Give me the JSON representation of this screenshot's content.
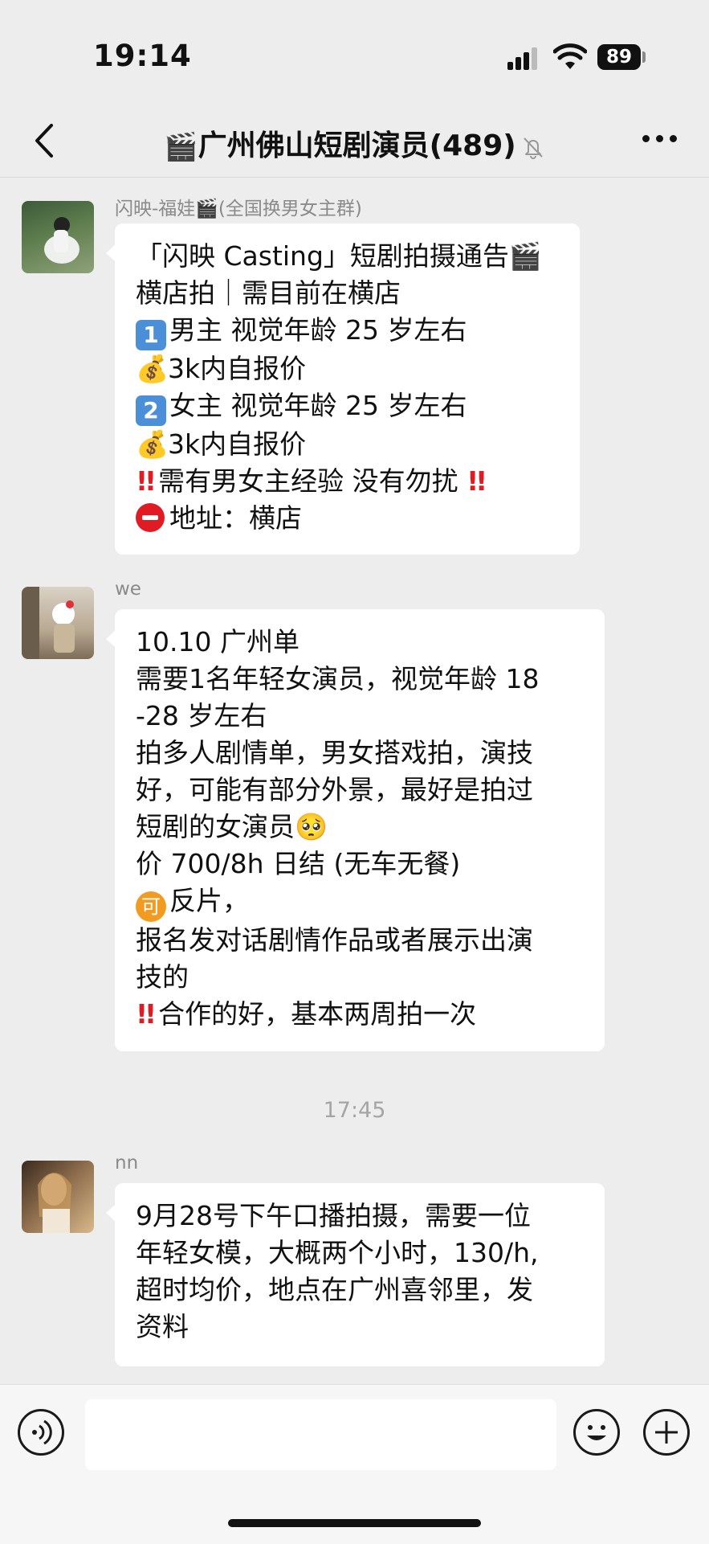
{
  "status_bar": {
    "time": "19:14",
    "battery": "89"
  },
  "header": {
    "icon": "🎬",
    "title": "广州佛山短剧演员(489)",
    "muted_icon": "bell-slash-icon",
    "back_icon": "chevron-left-icon",
    "more_icon": "ellipsis-icon"
  },
  "messages": [
    {
      "sender": "闪映-福娃🎬(全国换男女主群)",
      "lines": [
        "「闪映 Casting」短剧拍摄通告🎬",
        "横店拍｜需目前在横店",
        "男主 视觉年龄 25 岁左右",
        "3k内自报价",
        "女主 视觉年龄 25 岁左右",
        "3k内自报价",
        "需有男女主经验 没有勿扰",
        "地址：横店"
      ],
      "emoji": {
        "money": "💰",
        "one": "1",
        "two": "2",
        "bang": "!!"
      }
    },
    {
      "sender": "we",
      "lines": [
        "10.10 广州单",
        "需要1名年轻女演员，视觉年龄 18",
        "-28 岁左右",
        "拍多人剧情单，男女搭戏拍，演技",
        "好，可能有部分外景，最好是拍过",
        "短剧的女演员",
        "价 700/8h 日结 (无车无餐)",
        "反片，",
        "报名发对话剧情作品或者展示出演",
        "技的",
        "合作的好，基本两周拍一次"
      ],
      "emoji": {
        "pleading": "🥺",
        "ke": "可",
        "bang": "!!"
      }
    },
    {
      "timestamp": "17:45"
    },
    {
      "sender": "nn",
      "lines": [
        "9月28号下午口播拍摄，需要一位",
        "年轻女模，大概两个小时，130/h,",
        "超时均价，地点在广州喜邻里，发",
        "资料"
      ]
    }
  ],
  "input_bar": {
    "voice_icon": "voice-icon",
    "emoji_icon": "smiley-icon",
    "plus_icon": "plus-icon"
  }
}
